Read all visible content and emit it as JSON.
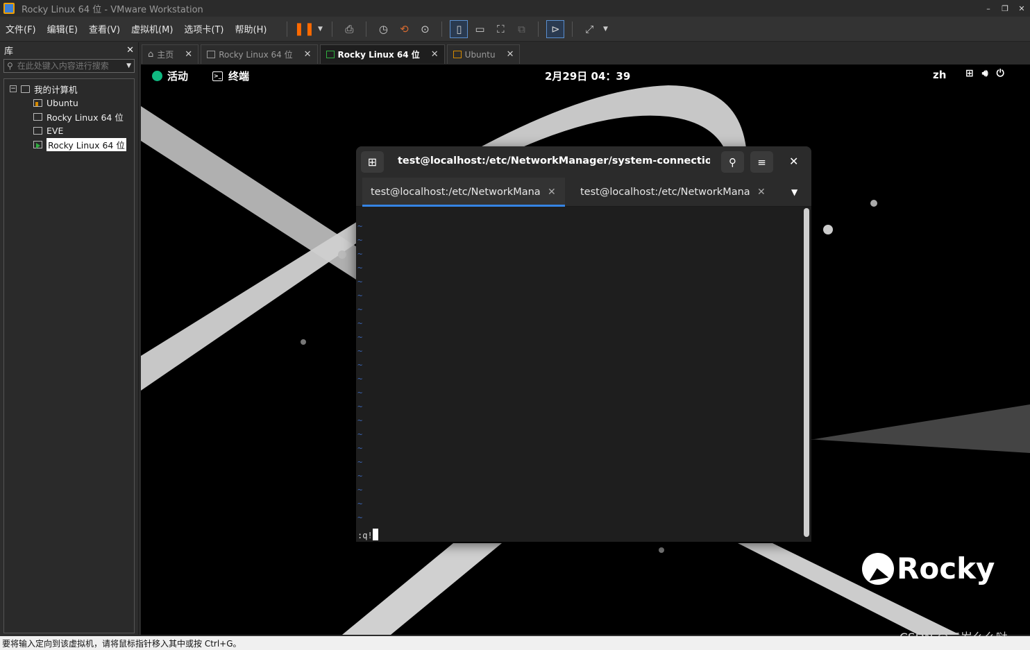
{
  "window": {
    "title": "Rocky Linux 64 位 - VMware Workstation"
  },
  "menu": [
    "文件(F)",
    "编辑(E)",
    "查看(V)",
    "虚拟机(M)",
    "选项卡(T)",
    "帮助(H)"
  ],
  "library": {
    "title": "库",
    "search_placeholder": "在此处键入内容进行搜索",
    "root": "我的计算机",
    "vms": [
      {
        "label": "Ubuntu",
        "state": "running"
      },
      {
        "label": "Rocky Linux 64 位",
        "state": "off"
      },
      {
        "label": "EVE",
        "state": "off"
      },
      {
        "label": "Rocky Linux 64 位",
        "state": "play",
        "selected": true
      }
    ]
  },
  "vm_tabs": [
    {
      "label": "主页"
    },
    {
      "label": "Rocky Linux 64 位"
    },
    {
      "label": "Rocky Linux 64 位",
      "active": true
    },
    {
      "label": "Ubuntu"
    }
  ],
  "gnome": {
    "activities": "活动",
    "app": "终端",
    "clock": "2月29日  04：39",
    "lang": "zh"
  },
  "terminal": {
    "title": "test@localhost:/etc/NetworkManager/system-connections — /···",
    "tabs": [
      {
        "label": "test@localhost:/etc/NetworkMana···",
        "active": true
      },
      {
        "label": "test@localhost:/etc/NetworkMana···"
      }
    ],
    "tilde": "~",
    "command": ":q!"
  },
  "branding": {
    "logo_text": "Rocky"
  },
  "statusbar": {
    "text": "要将输入定向到该虚拟机，请将鼠标指针移入其中或按 Ctrl+G。"
  },
  "watermark": "CSDN @三岁么么哒",
  "colors": {
    "accent": "#3584e4",
    "pause": "#ff6a00",
    "rocky_green": "#10b981"
  }
}
